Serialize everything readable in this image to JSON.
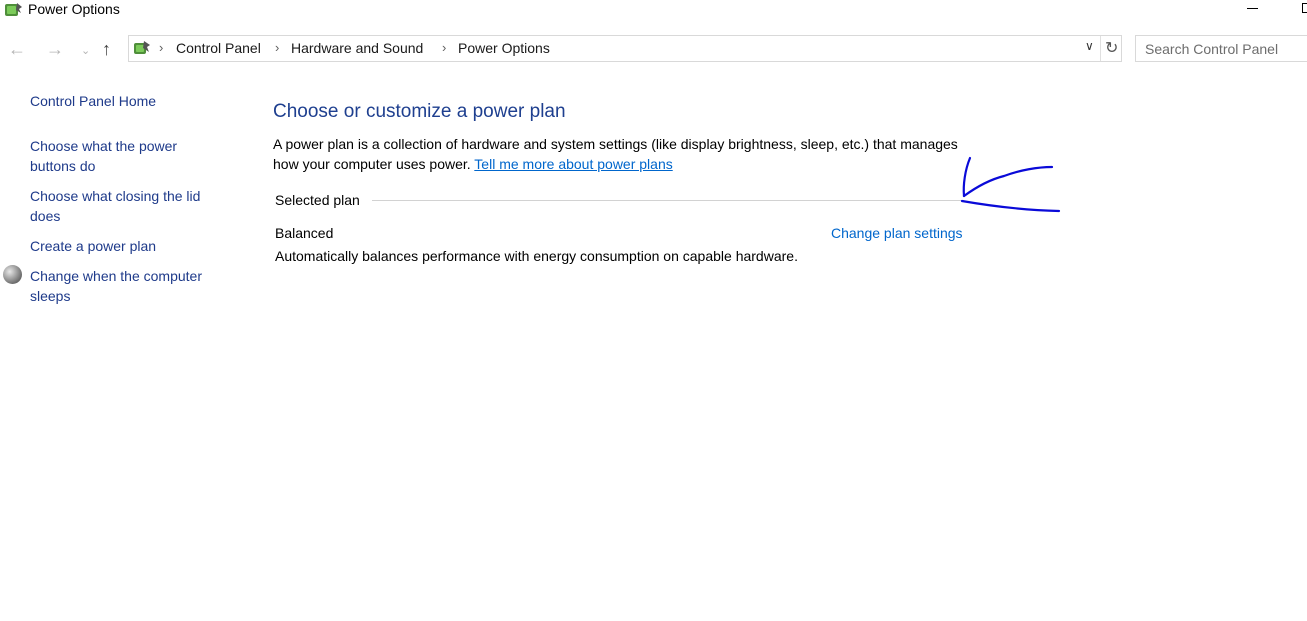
{
  "window": {
    "title": "Power Options"
  },
  "address_bar": {
    "crumbs": [
      "Control Panel",
      "Hardware and Sound",
      "Power Options"
    ]
  },
  "search": {
    "placeholder": "Search Control Panel"
  },
  "sidebar": {
    "items": [
      {
        "lines": [
          "Control Panel Home"
        ]
      },
      {
        "lines": [
          "Choose what the power",
          "buttons do"
        ]
      },
      {
        "lines": [
          "Choose what closing the lid",
          "does"
        ]
      },
      {
        "lines": [
          "Create a power plan"
        ]
      },
      {
        "lines": [
          "Change when the computer",
          "sleeps"
        ]
      }
    ]
  },
  "main": {
    "title": "Choose or customize a power plan",
    "description": "A power plan is a collection of hardware and system settings (like display brightness, sleep, etc.) that manages how your computer uses power.",
    "description_link": "Tell me more about power plans",
    "section_label": "Selected plan",
    "plan": {
      "name": "Balanced",
      "settings_link": "Change plan settings",
      "description": "Automatically balances performance with energy consumption on capable hardware."
    }
  },
  "colors": {
    "link": "#0066cc",
    "heading": "#1e3f8f",
    "annotation": "#0a0ad8"
  },
  "icons": [
    "power-options-icon",
    "back-arrow-icon",
    "forward-arrow-icon",
    "recent-dropdown-icon",
    "up-arrow-icon",
    "chevron-right-icon",
    "chevron-down-icon",
    "refresh-icon",
    "moon-sleep-icon"
  ]
}
